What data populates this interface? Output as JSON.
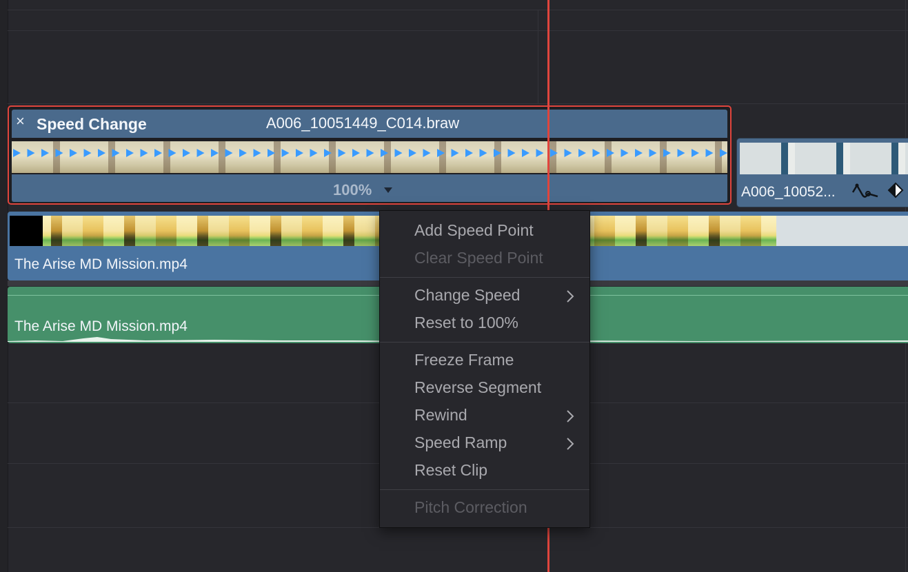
{
  "timeline": {
    "speed_clip": {
      "title": "Speed Change",
      "clip_name": "A006_10051449_C014.braw",
      "speed_percent": "100%",
      "close_glyph": "×"
    },
    "second_clip": {
      "name": "A006_10052..."
    },
    "video_clip": {
      "name": "The Arise MD Mission.mp4"
    },
    "audio_clip": {
      "name": "The Arise MD Mission.mp4"
    }
  },
  "context_menu": {
    "items": [
      {
        "label": "Add Speed Point",
        "enabled": true
      },
      {
        "label": "Clear Speed Point",
        "enabled": false
      },
      {
        "label": "Change Speed",
        "enabled": true,
        "submenu": true
      },
      {
        "label": "Reset to 100%",
        "enabled": true
      },
      {
        "label": "Freeze Frame",
        "enabled": true
      },
      {
        "label": "Reverse Segment",
        "enabled": true
      },
      {
        "label": "Rewind",
        "enabled": true,
        "submenu": true
      },
      {
        "label": "Speed Ramp",
        "enabled": true,
        "submenu": true
      },
      {
        "label": "Reset Clip",
        "enabled": true
      },
      {
        "label": "Pitch Correction",
        "enabled": false
      }
    ]
  },
  "colors": {
    "selection_border": "#e0453d",
    "playhead": "#e0453d",
    "video_clip": "#4a74a1",
    "audio_clip": "#46906a",
    "speed_arrow": "#3a9bff"
  },
  "icons": [
    "close-icon",
    "curve-icon",
    "keyframe-diamond-icon",
    "chevron-right-icon",
    "speed-arrow-icon",
    "dropdown-caret-icon"
  ]
}
